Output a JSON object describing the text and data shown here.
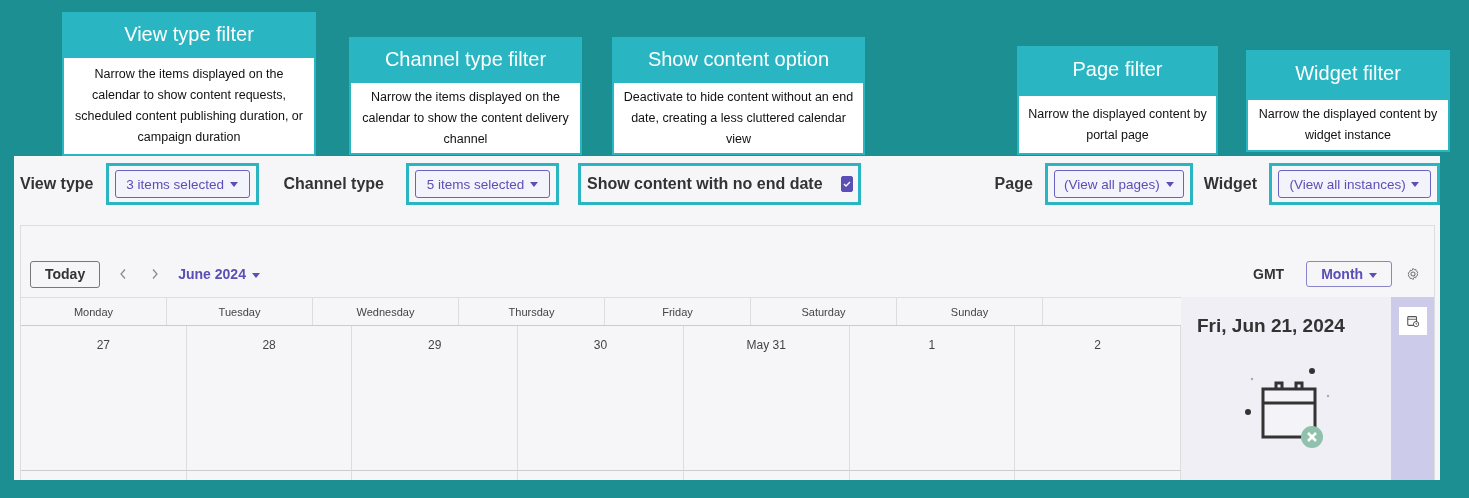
{
  "callouts": [
    {
      "title": "View type filter",
      "text": "Narrow the items displayed on the calendar to show content requests, scheduled content publishing duration, or campaign duration"
    },
    {
      "title": "Channel type filter",
      "text": "Narrow the items displayed on the calendar to show the content delivery channel"
    },
    {
      "title": "Show content option",
      "text": "Deactivate to hide content without an end date, creating a less cluttered calendar view"
    },
    {
      "title": "Page filter",
      "text": "Narrow the displayed content by portal page"
    },
    {
      "title": "Widget filter",
      "text": "Narrow the displayed content by widget instance"
    }
  ],
  "filter_bar": {
    "view_type": {
      "label": "View type",
      "value": "3 items selected"
    },
    "channel_type": {
      "label": "Channel type",
      "value": "5 items selected"
    },
    "no_end_date": {
      "label": "Show content with no end date",
      "checked": true
    },
    "page": {
      "label": "Page",
      "value": "(View all pages)"
    },
    "widget": {
      "label": "Widget",
      "value": "(View all instances)"
    }
  },
  "toolbar": {
    "today": "Today",
    "month": "June 2024",
    "timezone": "GMT",
    "view": "Month"
  },
  "weekdays": [
    "Monday",
    "Tuesday",
    "Wednesday",
    "Thursday",
    "Friday",
    "Saturday",
    "Sunday"
  ],
  "days": [
    "27",
    "28",
    "29",
    "30",
    "May 31",
    "1",
    "2"
  ],
  "side_panel": {
    "date": "Fri, Jun 21, 2024"
  }
}
